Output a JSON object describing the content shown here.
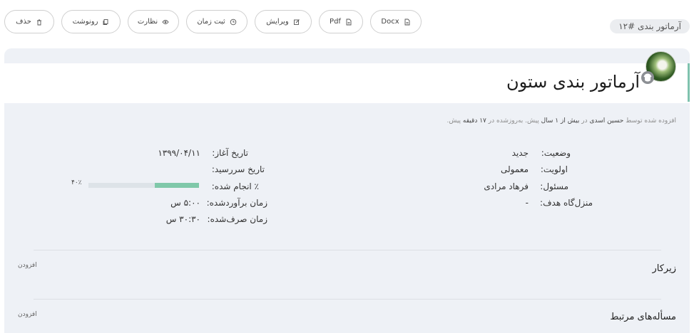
{
  "toolbar": {
    "buttons": [
      {
        "label": "حذف",
        "icon": "trash-icon"
      },
      {
        "label": "رونوشت",
        "icon": "copy-icon"
      },
      {
        "label": "نظارت",
        "icon": "eye-icon"
      },
      {
        "label": "ثبت زمان",
        "icon": "clock-icon"
      },
      {
        "label": "ویرایش",
        "icon": "edit-icon"
      },
      {
        "label": "Pdf",
        "icon": "file-icon"
      },
      {
        "label": "Docx",
        "icon": "file-icon"
      }
    ]
  },
  "issue": {
    "tag": "آرماتور بندی #۱۲",
    "title": "آرماتور بندی ستون",
    "meta": {
      "prefix": "افزوده شده توسط",
      "author": "حسین اسدی",
      "in": "در",
      "created_ago": "بیش از ۱ سال",
      "mid": "پیش. به‌روزشده در",
      "updated_ago": "۱۷ دقیقه",
      "suffix": "پیش."
    }
  },
  "attributes": {
    "status": {
      "label": "وضعیت:",
      "value": "جدید"
    },
    "priority": {
      "label": "اولویت:",
      "value": "معمولی"
    },
    "assignee": {
      "label": "مسئول:",
      "value": "فرهاد مرادی"
    },
    "target_version": {
      "label": "منزل‌گاه هدف:",
      "value": "-"
    },
    "start_date": {
      "label": "تاریخ آغاز:",
      "value": "۱۳۹۹/۰۴/۱۱"
    },
    "due_date": {
      "label": "تاریخ سررسید:",
      "value": ""
    },
    "done_ratio": {
      "label": "٪ انجام شده:",
      "value": 40,
      "text": "۴۰٪"
    },
    "estimated_time": {
      "label": "زمان برآوردشده:",
      "value": "۵:۰۰ س"
    },
    "spent_time": {
      "label": "زمان صرف‌شده:",
      "value": "۳۰:۳۰ س"
    }
  },
  "sections": {
    "subtasks": {
      "title": "زیرکار",
      "add": "افزودن"
    },
    "relations": {
      "title": "مسأله‌های مرتبط",
      "add": "افزودن"
    }
  },
  "colors": {
    "accent": "#7fc2ae",
    "progress": "#7fc8a9",
    "panel": "#eef1f6"
  }
}
